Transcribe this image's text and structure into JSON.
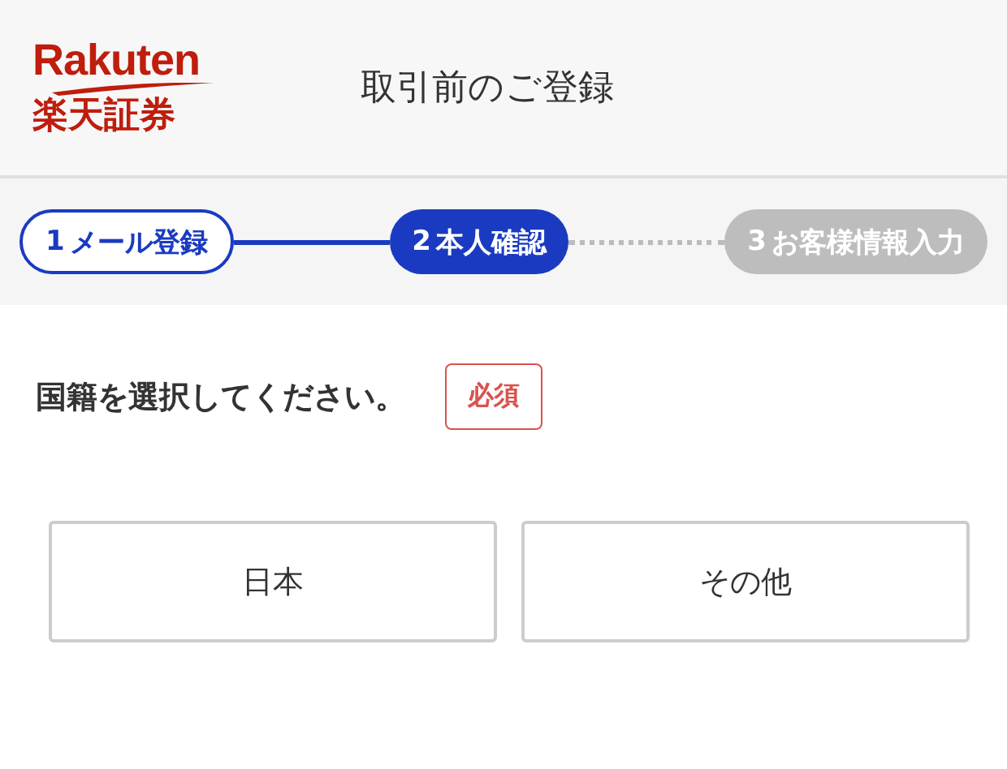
{
  "header": {
    "logo": {
      "wordmark": "Rakuten",
      "subtitle": "楽天証券"
    },
    "title": "取引前のご登録"
  },
  "steps": [
    {
      "number": "1",
      "label": "メール登録",
      "kind": "done"
    },
    {
      "number": "2",
      "label": "本人確認",
      "kind": "current"
    },
    {
      "number": "3",
      "label": "お客様情報入力",
      "kind": "upcoming"
    }
  ],
  "question": {
    "text": "国籍を選択してください。",
    "badge": "必須"
  },
  "options": [
    {
      "label": "日本",
      "selected": false
    },
    {
      "label": "その他",
      "selected": false
    }
  ]
}
